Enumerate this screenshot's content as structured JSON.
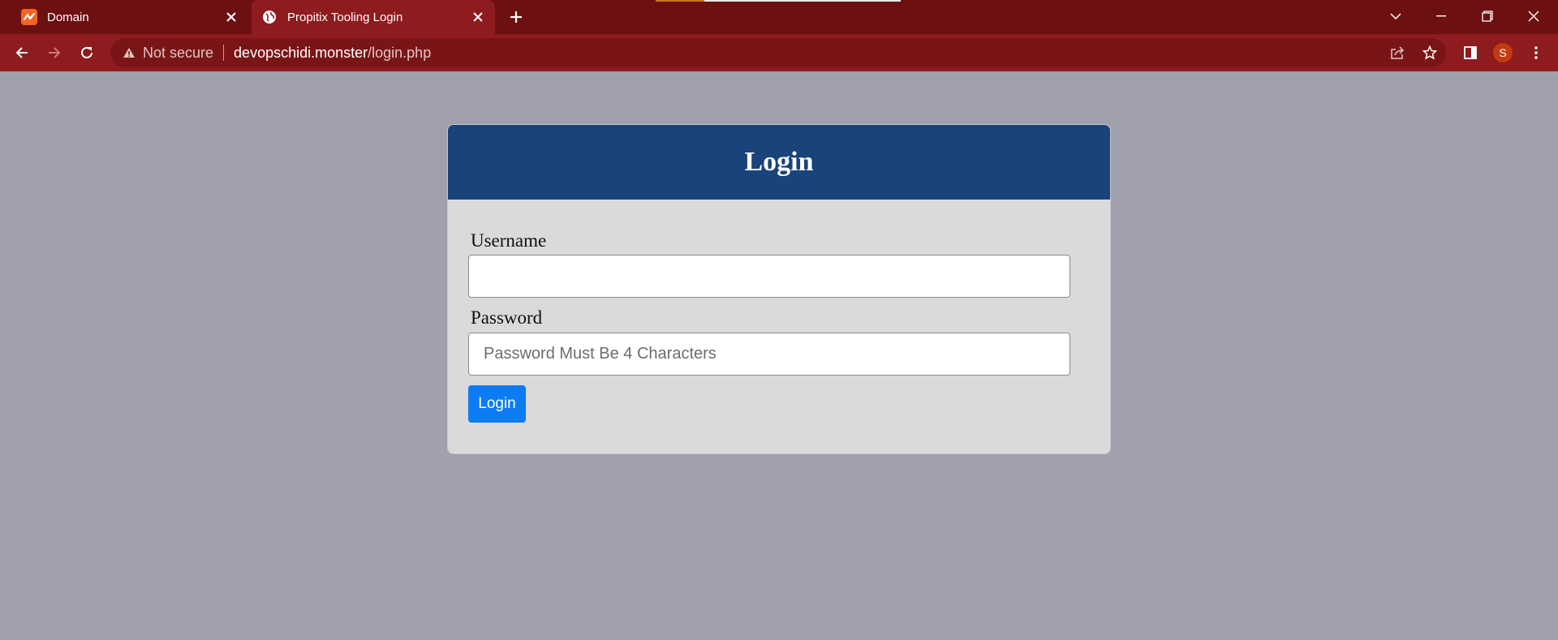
{
  "browser": {
    "tabs": [
      {
        "title": "Domain",
        "icon": "domain-favicon"
      },
      {
        "title": "Propitix Tooling Login",
        "icon": "globe-icon"
      }
    ],
    "security_label": "Not secure",
    "url_host": "devopschidi.monster",
    "url_path": "/login.php",
    "profile_initial": "S"
  },
  "colors": {
    "tabstrip": "#6d1012",
    "toolbar": "#8e1b1e",
    "page_background": "#a0a1ac",
    "card_header": "#1a437b",
    "card_body": "#dad9db",
    "login_button": "#0d7cf2"
  },
  "login": {
    "heading": "Login",
    "username_label": "Username",
    "username_value": "",
    "password_label": "Password",
    "password_placeholder": "Password Must Be 4 Characters",
    "button_label": "Login"
  }
}
